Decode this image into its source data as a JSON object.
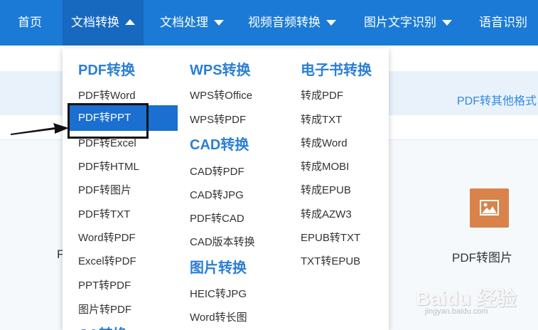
{
  "nav": {
    "home": "首页",
    "doc_convert": "文档转换",
    "doc_process": "文档处理",
    "video_audio": "视频音频转换",
    "image_ocr": "图片文字识别",
    "voice": "语音识别"
  },
  "page": {
    "subbar_link": "PDF转其他格式",
    "partial_char": "F",
    "feature_label": "PDF转图片",
    "watermark": "Baidu 经验",
    "watermark_sub": "jingyan.baidu.com"
  },
  "dropdown": {
    "pdf": {
      "title": "PDF转换",
      "items": [
        "PDF转Word",
        "PDF转PPT",
        "PDF转Excel",
        "PDF转HTML",
        "PDF转图片",
        "PDF转TXT",
        "Word转PDF",
        "Excel转PDF",
        "PPT转PDF",
        "图片转PDF"
      ]
    },
    "wps": {
      "title": "WPS转换",
      "items": [
        "WPS转Office",
        "WPS转PDF"
      ]
    },
    "cad": {
      "title": "CAD转换",
      "items": [
        "CAD转PDF",
        "CAD转JPG",
        "PDF转CAD",
        "CAD版本转换"
      ]
    },
    "image": {
      "title": "图片转换",
      "items": [
        "HEIC转JPG",
        "Word转长图"
      ]
    },
    "ca": {
      "title": "CA转换"
    },
    "ebook": {
      "title": "电子书转换",
      "items": [
        "转成PDF",
        "转成TXT",
        "转成Word",
        "转成MOBI",
        "转成EPUB",
        "转成AZW3",
        "EPUB转TXT",
        "TXT转EPUB"
      ]
    }
  },
  "colors": {
    "nav_bg": "#1a7ad6",
    "section_title": "#2b7fd4",
    "highlight": "#1a6fd0",
    "feature_icon": "#d9824a"
  }
}
